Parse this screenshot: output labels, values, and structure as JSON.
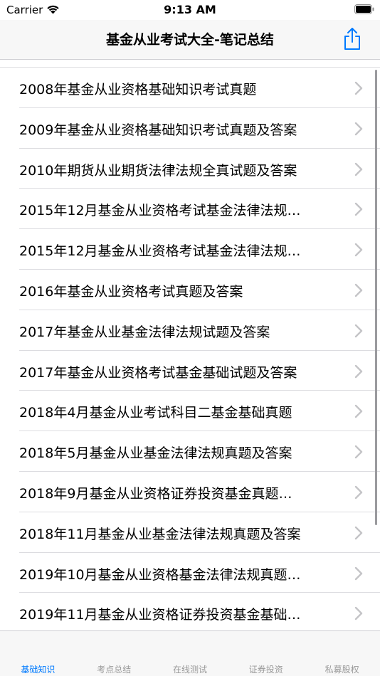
{
  "status_bar": {
    "carrier": "Carrier",
    "time": "9:13 AM"
  },
  "nav": {
    "title": "基金从业考试大全-笔记总结"
  },
  "colors": {
    "accent": "#007aff",
    "tab_inactive": "#999999",
    "separator": "#dcdce0"
  },
  "list": {
    "items": [
      "2008年基金从业资格基础知识考试真题",
      "2009年基金从业资格基础知识考试真题及答案",
      "2010年期货从业期货法律法规全真试题及答案",
      "2015年12月基金从业资格考试基金法律法规…",
      "2015年12月基金从业资格考试基金法律法规…",
      "2016年基金从业资格考试真题及答案",
      "2017年基金从业基金法律法规试题及答案",
      "2017年基金从业资格考试基金基础试题及答案",
      "2018年4月基金从业考试科目二基金基础真题",
      "2018年5月基金从业基金法律法规真题及答案",
      "2018年9月基金从业资格证券投资基金真题…",
      "2018年11月基金从业基金法律法规真题及答案",
      "2019年10月基金从业资格基金法律法规真题…",
      "2019年11月基金从业资格证券投资基金基础…"
    ]
  },
  "tabs": [
    {
      "label": "基础知识",
      "active": true
    },
    {
      "label": "考点总结",
      "active": false
    },
    {
      "label": "在线测试",
      "active": false
    },
    {
      "label": "证券投资",
      "active": false
    },
    {
      "label": "私募股权",
      "active": false
    }
  ]
}
